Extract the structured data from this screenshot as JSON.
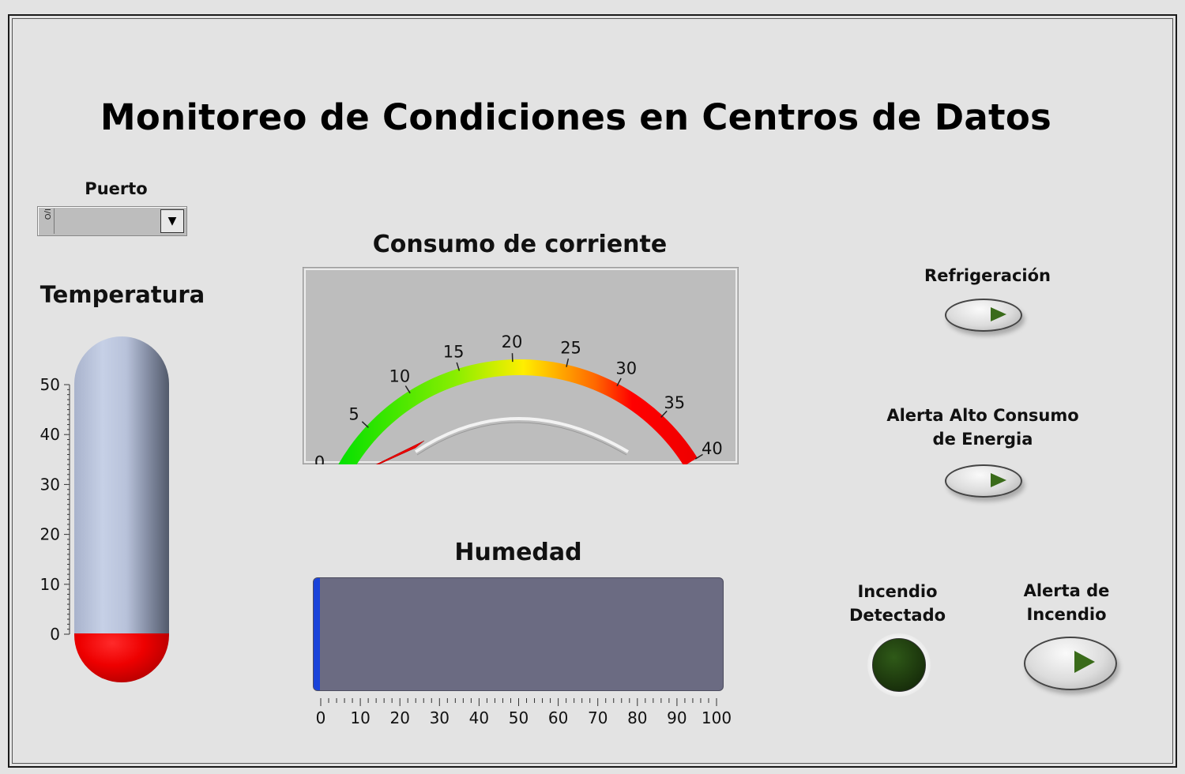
{
  "title": "Monitoreo de Condiciones en Centros de Datos",
  "port": {
    "label": "Puerto",
    "io_glyph": "I/O",
    "value": ""
  },
  "temperature": {
    "label": "Temperatura",
    "ticks": [
      "0",
      "10",
      "20",
      "30",
      "40",
      "50"
    ],
    "value": 0,
    "min": 0,
    "max": 50
  },
  "current": {
    "label": "Consumo de corriente",
    "ticks": [
      "0",
      "5",
      "10",
      "15",
      "20",
      "25",
      "30",
      "35",
      "40"
    ],
    "value": 0,
    "min": 0,
    "max": 40
  },
  "humidity": {
    "label": "Humedad",
    "ticks": [
      "0",
      "10",
      "20",
      "30",
      "40",
      "50",
      "60",
      "70",
      "80",
      "90",
      "100"
    ],
    "value": 1.5,
    "min": 0,
    "max": 100
  },
  "indicators": {
    "cooling": {
      "label": "Refrigeración",
      "state": "off"
    },
    "high_energy": {
      "label_line1": "Alerta Alto Consumo",
      "label_line2": "de Energia",
      "state": "off"
    },
    "fire_detected": {
      "label_line1": "Incendio",
      "label_line2": "Detectado",
      "state": "off"
    },
    "fire_alert": {
      "label_line1": "Alerta de",
      "label_line2": "Incendio",
      "state": "off"
    }
  },
  "colors": {
    "background": "#e3e3e3",
    "bulb": "#ee0000",
    "bar_fill": "#1a43d9",
    "bar_track": "#6b6b82",
    "led_off": "#1e3a0e"
  }
}
